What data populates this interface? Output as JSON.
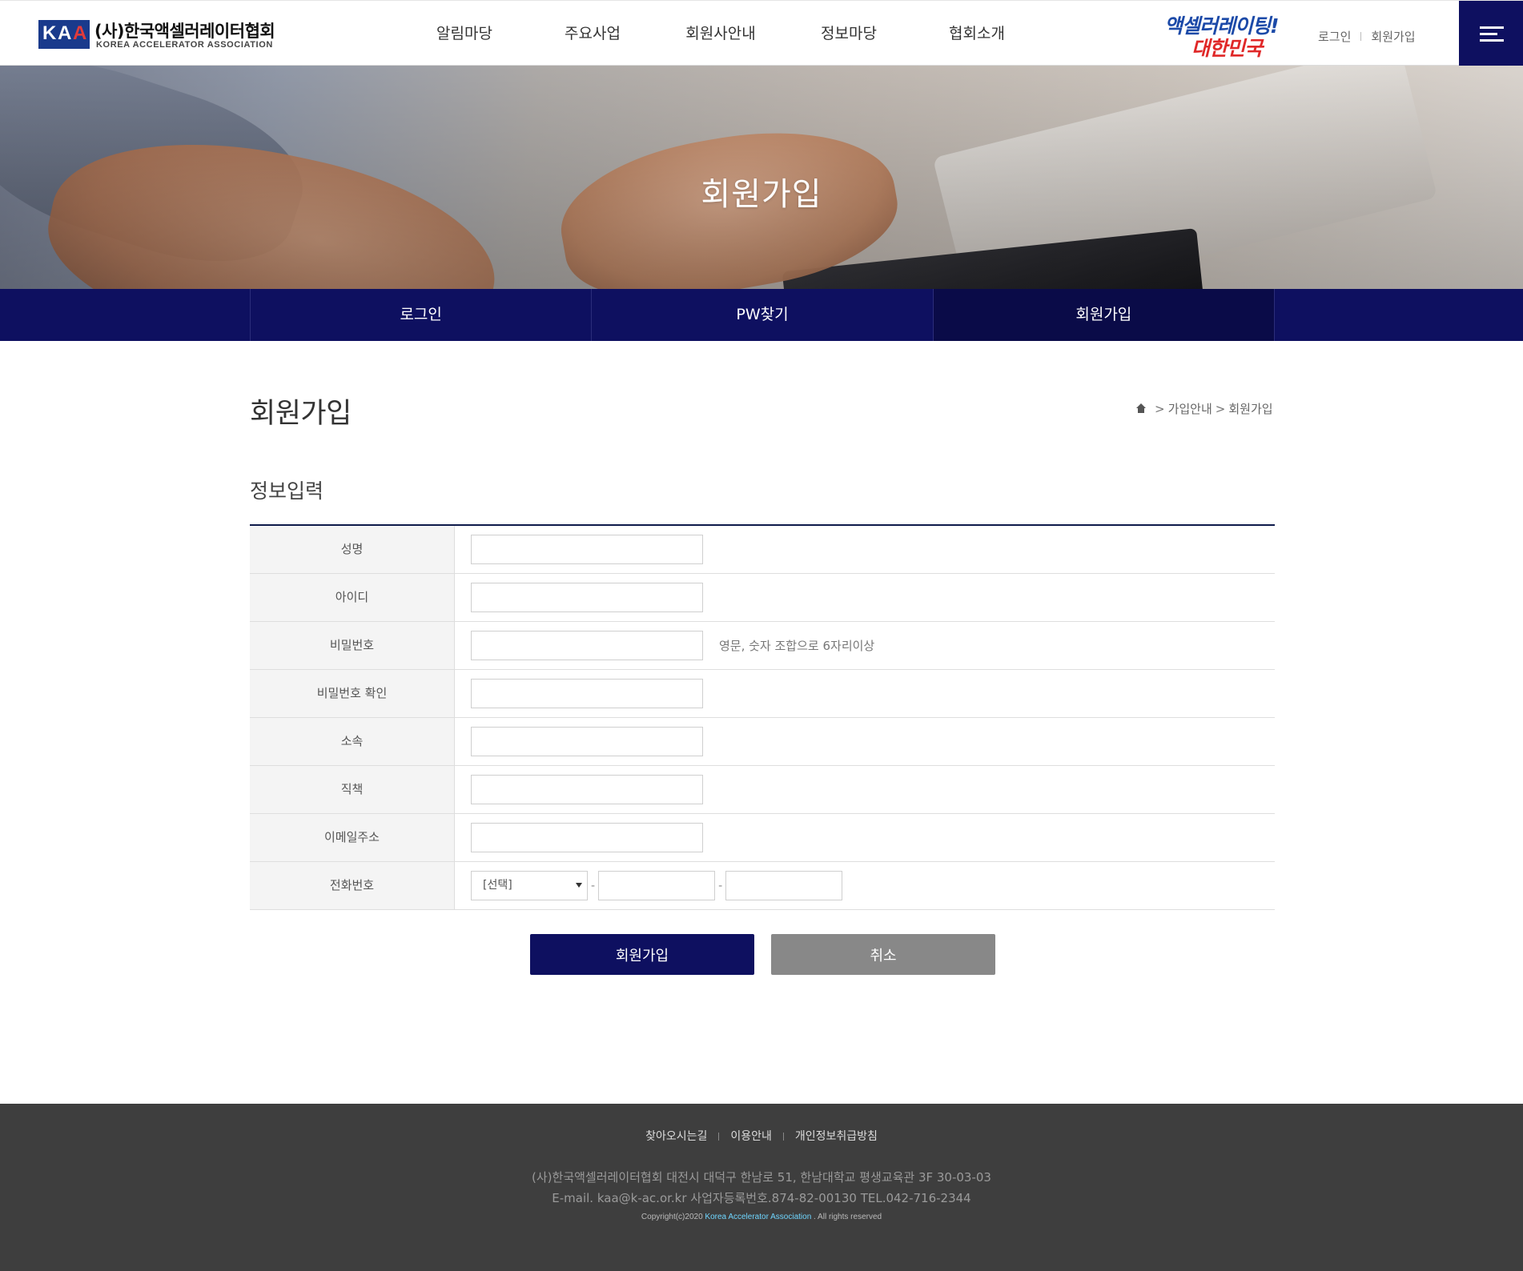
{
  "header": {
    "logo_letters": [
      "K",
      "A",
      "A"
    ],
    "logo_name_ko": "(사)한국액셀러레이터협회",
    "logo_name_en": "KOREA ACCELERATOR ASSOCIATION",
    "nav": [
      "알림마당",
      "주요사업",
      "회원사안내",
      "정보마당",
      "협회소개"
    ],
    "slogan_line1": "액셀러레이팅!",
    "slogan_line2": "대한민국",
    "util_login": "로그인",
    "util_join": "회원가입",
    "menu_icon": "hamburger-icon"
  },
  "hero": {
    "title": "회원가입"
  },
  "subnav": {
    "tabs": [
      {
        "label": "로그인",
        "active": false
      },
      {
        "label": "PW찾기",
        "active": false
      },
      {
        "label": "회원가입",
        "active": true
      }
    ]
  },
  "content": {
    "page_title": "회원가입",
    "breadcrumb": {
      "home_icon": "home-icon",
      "items": [
        "가입안내",
        "회원가입"
      ]
    },
    "section_title": "정보입력",
    "form": {
      "rows": [
        {
          "label": "성명",
          "value": ""
        },
        {
          "label": "아이디",
          "value": ""
        },
        {
          "label": "비밀번호",
          "value": "",
          "hint": "영문, 숫자 조합으로 6자리이상"
        },
        {
          "label": "비밀번호 확인",
          "value": ""
        },
        {
          "label": "소속",
          "value": ""
        },
        {
          "label": "직책",
          "value": ""
        },
        {
          "label": "이메일주소",
          "value": ""
        },
        {
          "label": "전화번호",
          "select_value": "[선택]",
          "dash": "-",
          "phone_mid": "",
          "phone_last": ""
        }
      ]
    },
    "buttons": {
      "submit": "회원가입",
      "cancel": "취소"
    }
  },
  "footer": {
    "links": [
      "찾아오시는길",
      "이용안내",
      "개인정보취급방침"
    ],
    "address": "(사)한국액셀러레이터협회 대전시 대덕구 한남로 51, 한남대학교 평생교육관 3F 30-03-03",
    "contact": "E-mail. kaa@k-ac.or.kr 사업자등록번호.874-82-00130 TEL.042-716-2344",
    "copyright_prefix": "Copyright(c)2020 ",
    "copyright_org": "Korea  Accelerator Association",
    "copyright_suffix": " . All rights reserved"
  },
  "colors": {
    "primary_navy": "#0e1060",
    "cancel_gray": "#888888",
    "footer_bg": "#3e3e3e",
    "slogan_blue": "#1c4aa8",
    "slogan_red": "#e02828"
  }
}
